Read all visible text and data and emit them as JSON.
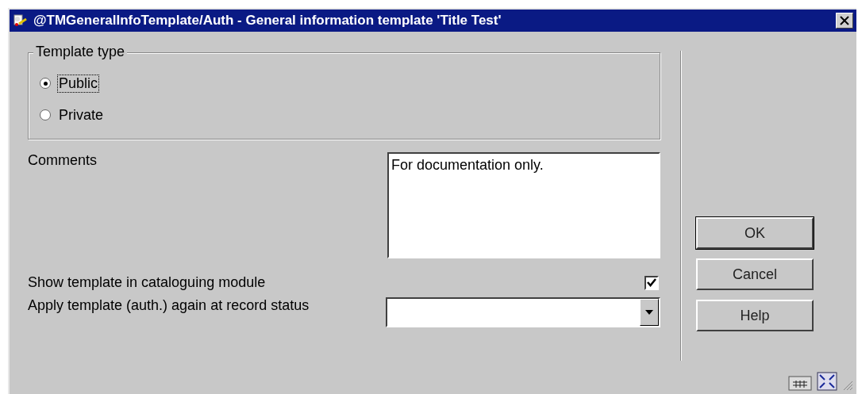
{
  "window": {
    "title": "@TMGeneralInfoTemplate/Auth - General information template 'Title Test'"
  },
  "template_type": {
    "legend": "Template type",
    "options": [
      {
        "label": "Public",
        "selected": true,
        "focused": true
      },
      {
        "label": "Private",
        "selected": false,
        "focused": false
      }
    ]
  },
  "comments": {
    "label": "Comments",
    "value": "For documentation only."
  },
  "show_in_cataloguing": {
    "label": "Show template in cataloguing module",
    "checked": true
  },
  "apply_again": {
    "label": "Apply template (auth.) again at record status"
  },
  "buttons": [
    {
      "label": "OK",
      "default": true
    },
    {
      "label": "Cancel",
      "default": false
    },
    {
      "label": "Help",
      "default": false
    }
  ]
}
